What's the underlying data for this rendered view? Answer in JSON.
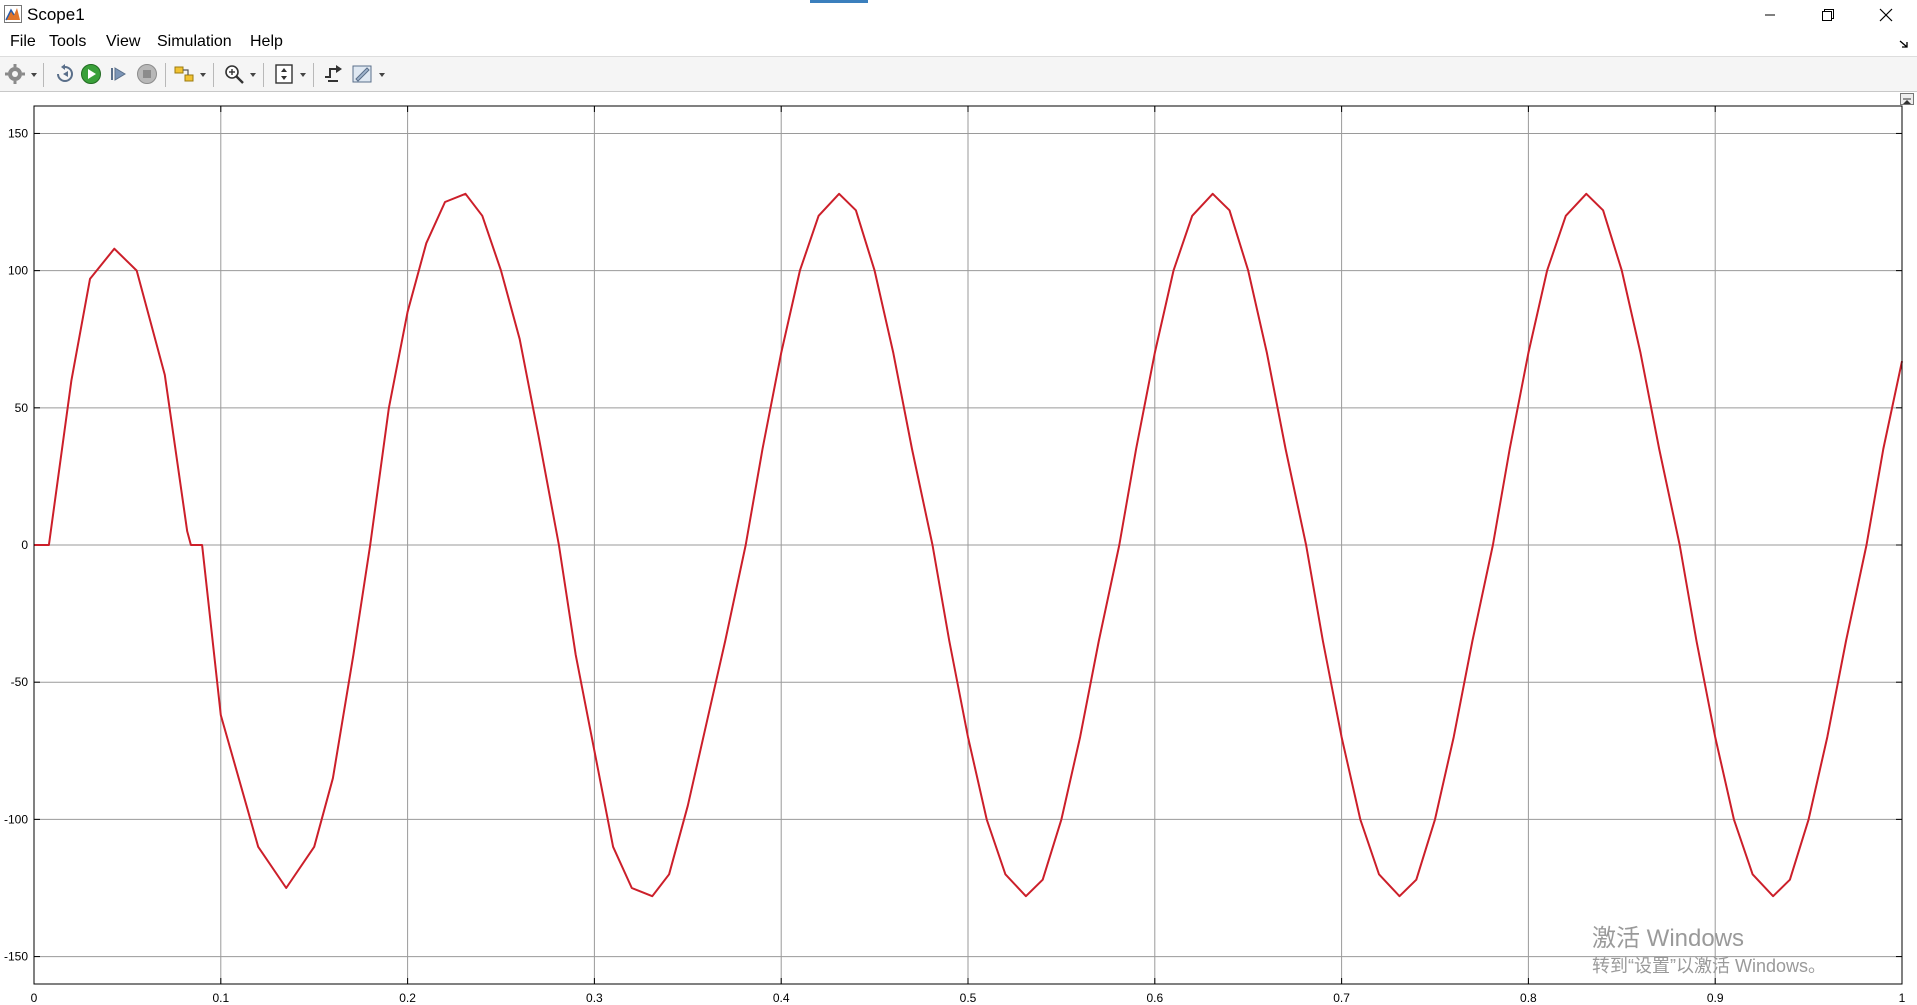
{
  "window": {
    "title": "Scope1"
  },
  "window_controls": [
    "minimize-icon",
    "restore-icon",
    "close-icon"
  ],
  "menu": [
    {
      "label": "File"
    },
    {
      "label": "Tools"
    },
    {
      "label": "View"
    },
    {
      "label": "Simulation"
    },
    {
      "label": "Help"
    }
  ],
  "toolbar": [
    "settings-gear-icon",
    "step-back-icon",
    "run-icon",
    "step-forward-icon",
    "stop-icon",
    "highlight-simulink-block-icon",
    "zoom-in-icon",
    "scale-axes-icon",
    "trigger-icon",
    "style-icon"
  ],
  "colors": {
    "signal": "#cc1f2a",
    "grid": "#9a9a9a",
    "axes": "#000000",
    "background": "#ffffff",
    "toolbar_bg": "#f5f5f5",
    "run_green": "#3aa03a"
  },
  "chart_data": {
    "type": "line",
    "title": "",
    "xlabel": "",
    "ylabel": "",
    "xlim": [
      0,
      1
    ],
    "ylim": [
      -160,
      160
    ],
    "xticks": [
      0,
      0.1,
      0.2,
      0.3,
      0.4,
      0.5,
      0.6,
      0.7,
      0.8,
      0.9,
      1
    ],
    "xtick_labels": [
      "0",
      "0.1",
      "0.2",
      "0.3",
      "0.4",
      "0.5",
      "0.6",
      "0.7",
      "0.8",
      "0.9",
      "1"
    ],
    "yticks": [
      150,
      100,
      50,
      0,
      -50,
      -100,
      -150
    ],
    "ytick_labels": [
      "150",
      "100",
      "50",
      "0",
      "-50",
      "-100",
      "-150"
    ],
    "grid": true,
    "series": [
      {
        "color": "#cc1f2a",
        "x": [
          0,
          0.008,
          0.02,
          0.03,
          0.043,
          0.055,
          0.07,
          0.082,
          0.084,
          0.09,
          0.1,
          0.12,
          0.135,
          0.15,
          0.16,
          0.171,
          0.18,
          0.19,
          0.2,
          0.21,
          0.22,
          0.231,
          0.24,
          0.25,
          0.26,
          0.27,
          0.281,
          0.29,
          0.3,
          0.31,
          0.32,
          0.331,
          0.34,
          0.35,
          0.36,
          0.37,
          0.381,
          0.39,
          0.4,
          0.41,
          0.42,
          0.431,
          0.44,
          0.45,
          0.46,
          0.47,
          0.481,
          0.49,
          0.5,
          0.51,
          0.52,
          0.531,
          0.54,
          0.55,
          0.56,
          0.57,
          0.581,
          0.59,
          0.6,
          0.61,
          0.62,
          0.631,
          0.64,
          0.65,
          0.66,
          0.67,
          0.681,
          0.69,
          0.7,
          0.71,
          0.72,
          0.731,
          0.74,
          0.75,
          0.76,
          0.77,
          0.781,
          0.79,
          0.8,
          0.81,
          0.82,
          0.831,
          0.84,
          0.85,
          0.86,
          0.87,
          0.881,
          0.89,
          0.9,
          0.91,
          0.92,
          0.931,
          0.94,
          0.95,
          0.96,
          0.97,
          0.981,
          0.99,
          1.0
        ],
        "y": [
          0,
          0,
          60,
          97,
          108,
          100,
          62,
          5,
          0,
          0,
          -62,
          -110,
          -125,
          -110,
          -85,
          -40,
          0,
          50,
          85,
          110,
          125,
          128,
          120,
          100,
          75,
          40,
          0,
          -40,
          -75,
          -110,
          -125,
          -128,
          -120,
          -95,
          -65,
          -35,
          0,
          35,
          70,
          100,
          120,
          128,
          122,
          100,
          70,
          35,
          0,
          -35,
          -70,
          -100,
          -120,
          -128,
          -122,
          -100,
          -70,
          -35,
          0,
          35,
          70,
          100,
          120,
          128,
          122,
          100,
          70,
          35,
          0,
          -35,
          -70,
          -100,
          -120,
          -128,
          -122,
          -100,
          -70,
          -35,
          0,
          35,
          70,
          100,
          120,
          128,
          122,
          100,
          70,
          35,
          0,
          -35,
          -70,
          -100,
          -120,
          -128,
          -122,
          -100,
          -70,
          -35,
          0,
          35,
          67
        ]
      }
    ]
  },
  "watermark": {
    "line1": "激活 Windows",
    "line2": "转到“设置”以激活 Windows。"
  }
}
